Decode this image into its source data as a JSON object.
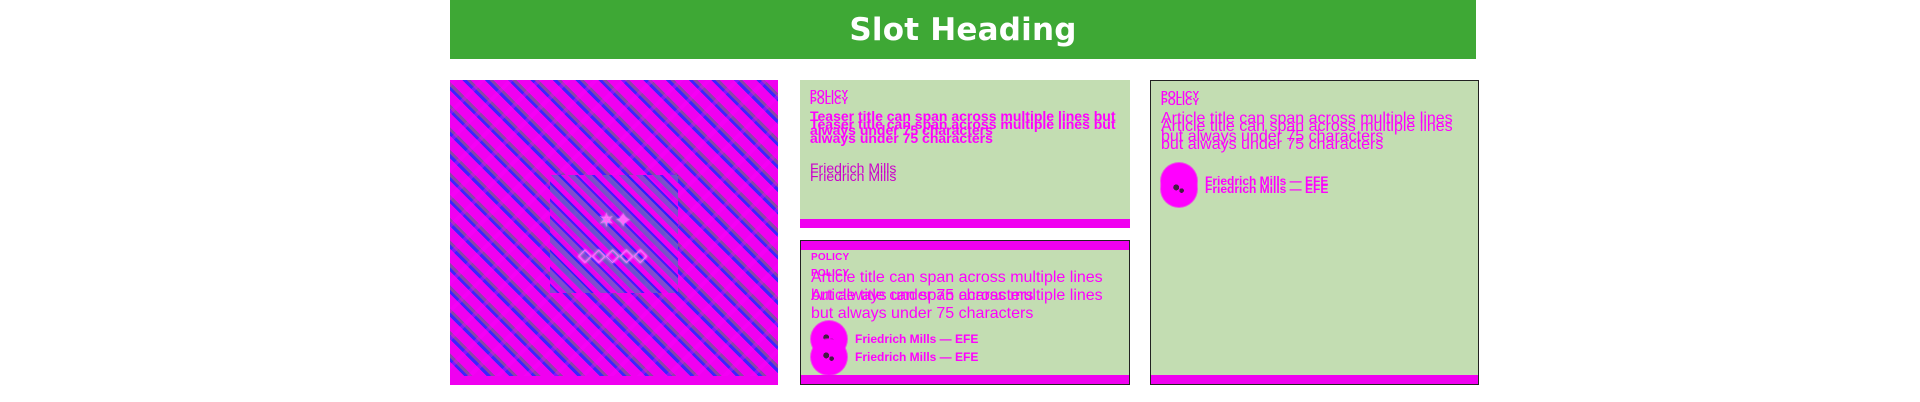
{
  "slot": {
    "heading": "Slot Heading",
    "accent_colors": {
      "heading_bg": "#3ea835",
      "card_bg": "#c3ddb2",
      "magenta": "#f000f0",
      "text_magenta": "#ff00ff"
    }
  },
  "featured": {
    "image_icon": "image-placeholder-icon"
  },
  "middle": {
    "card_a": {
      "kicker_1": "POLICY",
      "kicker_2": "POLICY",
      "teaser_1": "Teaser title can span across multiple lines but always under 75 characters",
      "teaser_2": "Teaser title can span across multiple lines but always under 75 characters",
      "author_1": "Friedrich Mills",
      "author_2": "Friedrich Mills"
    },
    "card_b": {
      "kicker_1": "POLICY",
      "kicker_2": "POLICY",
      "title_1": "Article title can span across multiple lines but always under 75 characters",
      "title_2": "Article title can span across multiple lines but always under 75 characters",
      "byline_1": "Friedrich Mills — EFE",
      "byline_2": "Friedrich Mills — EFE"
    }
  },
  "right": {
    "card_c": {
      "kicker_1": "POLICY",
      "kicker_2": "POLICY",
      "title_1": "Article title can span across multiple lines but always under 75 characters",
      "title_2": "Article title can span across multiple lines but always under 75 characters",
      "byline_1": "Friedrich Mills — EFE",
      "byline_2": "Friedrich Mills — EFE"
    }
  }
}
